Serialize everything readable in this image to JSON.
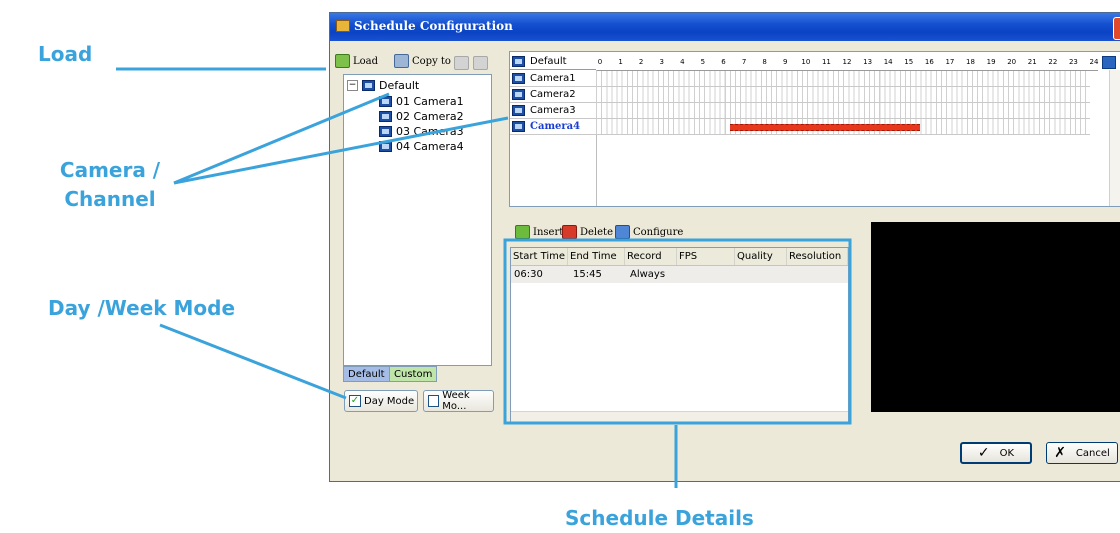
{
  "annotations": {
    "load": "Load",
    "camera_channel_line1": "Camera /",
    "camera_channel_line2": "Channel",
    "day_week_mode": "Day /Week Mode",
    "schedule_details": "Schedule Details"
  },
  "window": {
    "title": "Schedule Configuration",
    "close_glyph": "X"
  },
  "toolbar": {
    "load_label": "Load",
    "copy_to_label": "Copy to"
  },
  "tree": {
    "root": "Default",
    "expander": "−",
    "items": [
      "01 Camera1",
      "02 Camera2",
      "03 Camera3",
      "04 Camera4"
    ]
  },
  "tabs": {
    "default": "Default",
    "custom": "Custom"
  },
  "mode_buttons": {
    "day_mode": "Day Mode",
    "week_mode": "Week Mo...",
    "day_checked": true
  },
  "schedule_grid": {
    "header_label": "Default",
    "hours": [
      "0",
      "1",
      "2",
      "3",
      "4",
      "5",
      "6",
      "7",
      "8",
      "9",
      "10",
      "11",
      "12",
      "13",
      "14",
      "15",
      "16",
      "17",
      "18",
      "19",
      "20",
      "21",
      "22",
      "23",
      "24"
    ],
    "rows": [
      "Camera1",
      "Camera2",
      "Camera3",
      "Camera4"
    ],
    "selected_row": "Camera4",
    "recording_bar": {
      "camera": "Camera4",
      "start_hour": 6.5,
      "end_hour": 15.75,
      "color": "#e8371c"
    }
  },
  "schedule_toolbar": {
    "insert_label": "Insert",
    "delete_label": "Delete",
    "configure_label": "Configure"
  },
  "schedule_table": {
    "columns": [
      "Start Time",
      "End Time",
      "Record",
      "FPS",
      "Quality",
      "Resolution"
    ],
    "rows": [
      {
        "start": "06:30",
        "end": "15:45",
        "record": "Always",
        "fps": "",
        "quality": "",
        "resolution": ""
      }
    ]
  },
  "buttons": {
    "ok": "OK",
    "ok_glyph": "✓",
    "cancel": "Cancel",
    "cancel_glyph": "✗"
  },
  "colors": {
    "callout": "#3ba3dc",
    "title_bar": "#0a43c4",
    "selected_camera_text": "#1a3fd0"
  }
}
